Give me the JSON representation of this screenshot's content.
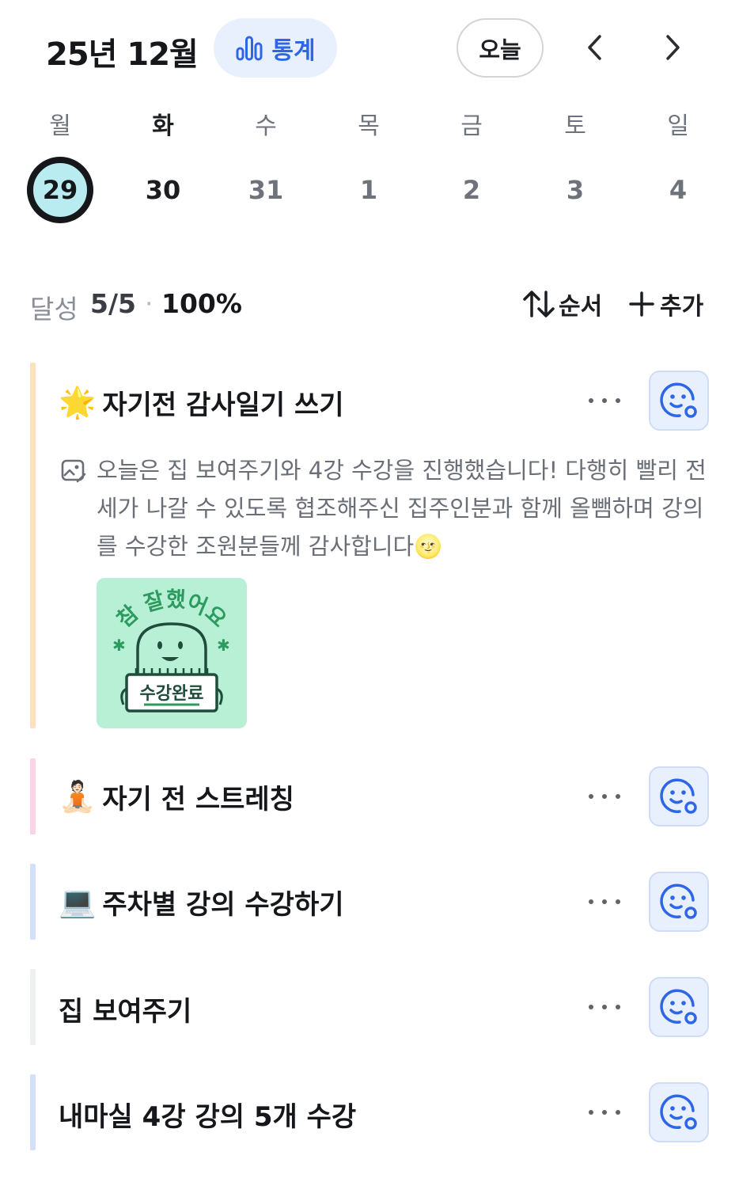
{
  "header": {
    "month_title": "25년 12월",
    "stats_label": "통계",
    "today_label": "오늘"
  },
  "week": {
    "days": [
      "월",
      "화",
      "수",
      "목",
      "금",
      "토",
      "일"
    ],
    "dates": [
      "29",
      "30",
      "31",
      "1",
      "2",
      "3",
      "4"
    ],
    "selected_index": 0
  },
  "summary": {
    "label": "달성",
    "count": "5/5",
    "separator": "·",
    "percent": "100%",
    "order_label": "순서",
    "add_label": "추가"
  },
  "tasks": [
    {
      "emoji": "🌟",
      "title": "자기전 감사일기 쓰기",
      "bar_color": "#fde0bd",
      "memo": "오늘은 집 보여주기와 4강 수강을 진행했습니다! 다행히 빨리 전세가 나갈 수 있도록 협조해주신 집주인분과 함께 올뺌하며 강의를 수강한 조원분들께 감사합니다🌝",
      "sticker_text": "참 잘했어요",
      "sticker_sign": "수강완료"
    },
    {
      "emoji": "🧘🏻",
      "title": "자기 전 스트레칭",
      "bar_color": "#fbd3e7"
    },
    {
      "emoji": "💻",
      "title": "주차별 강의 수강하기",
      "bar_color": "#d3e0fa"
    },
    {
      "emoji": "",
      "title": "집 보여주기",
      "bar_color": "#eeeff1"
    },
    {
      "emoji": "",
      "title": "내마실 4강 강의 5개 수강",
      "bar_color": "#d3e0fa"
    }
  ],
  "colors": {
    "accent": "#2d66e8",
    "accent_bg": "#e9f0fd",
    "today_circle": "#b9ecf1"
  },
  "icons": {
    "stats": "bar-chart-icon",
    "prev": "chevron-left-icon",
    "next": "chevron-right-icon",
    "order": "sort-arrows-icon",
    "add": "plus-icon",
    "more": "more-dots-icon",
    "mood": "smile-face-icon",
    "memo": "memo-image-icon"
  }
}
